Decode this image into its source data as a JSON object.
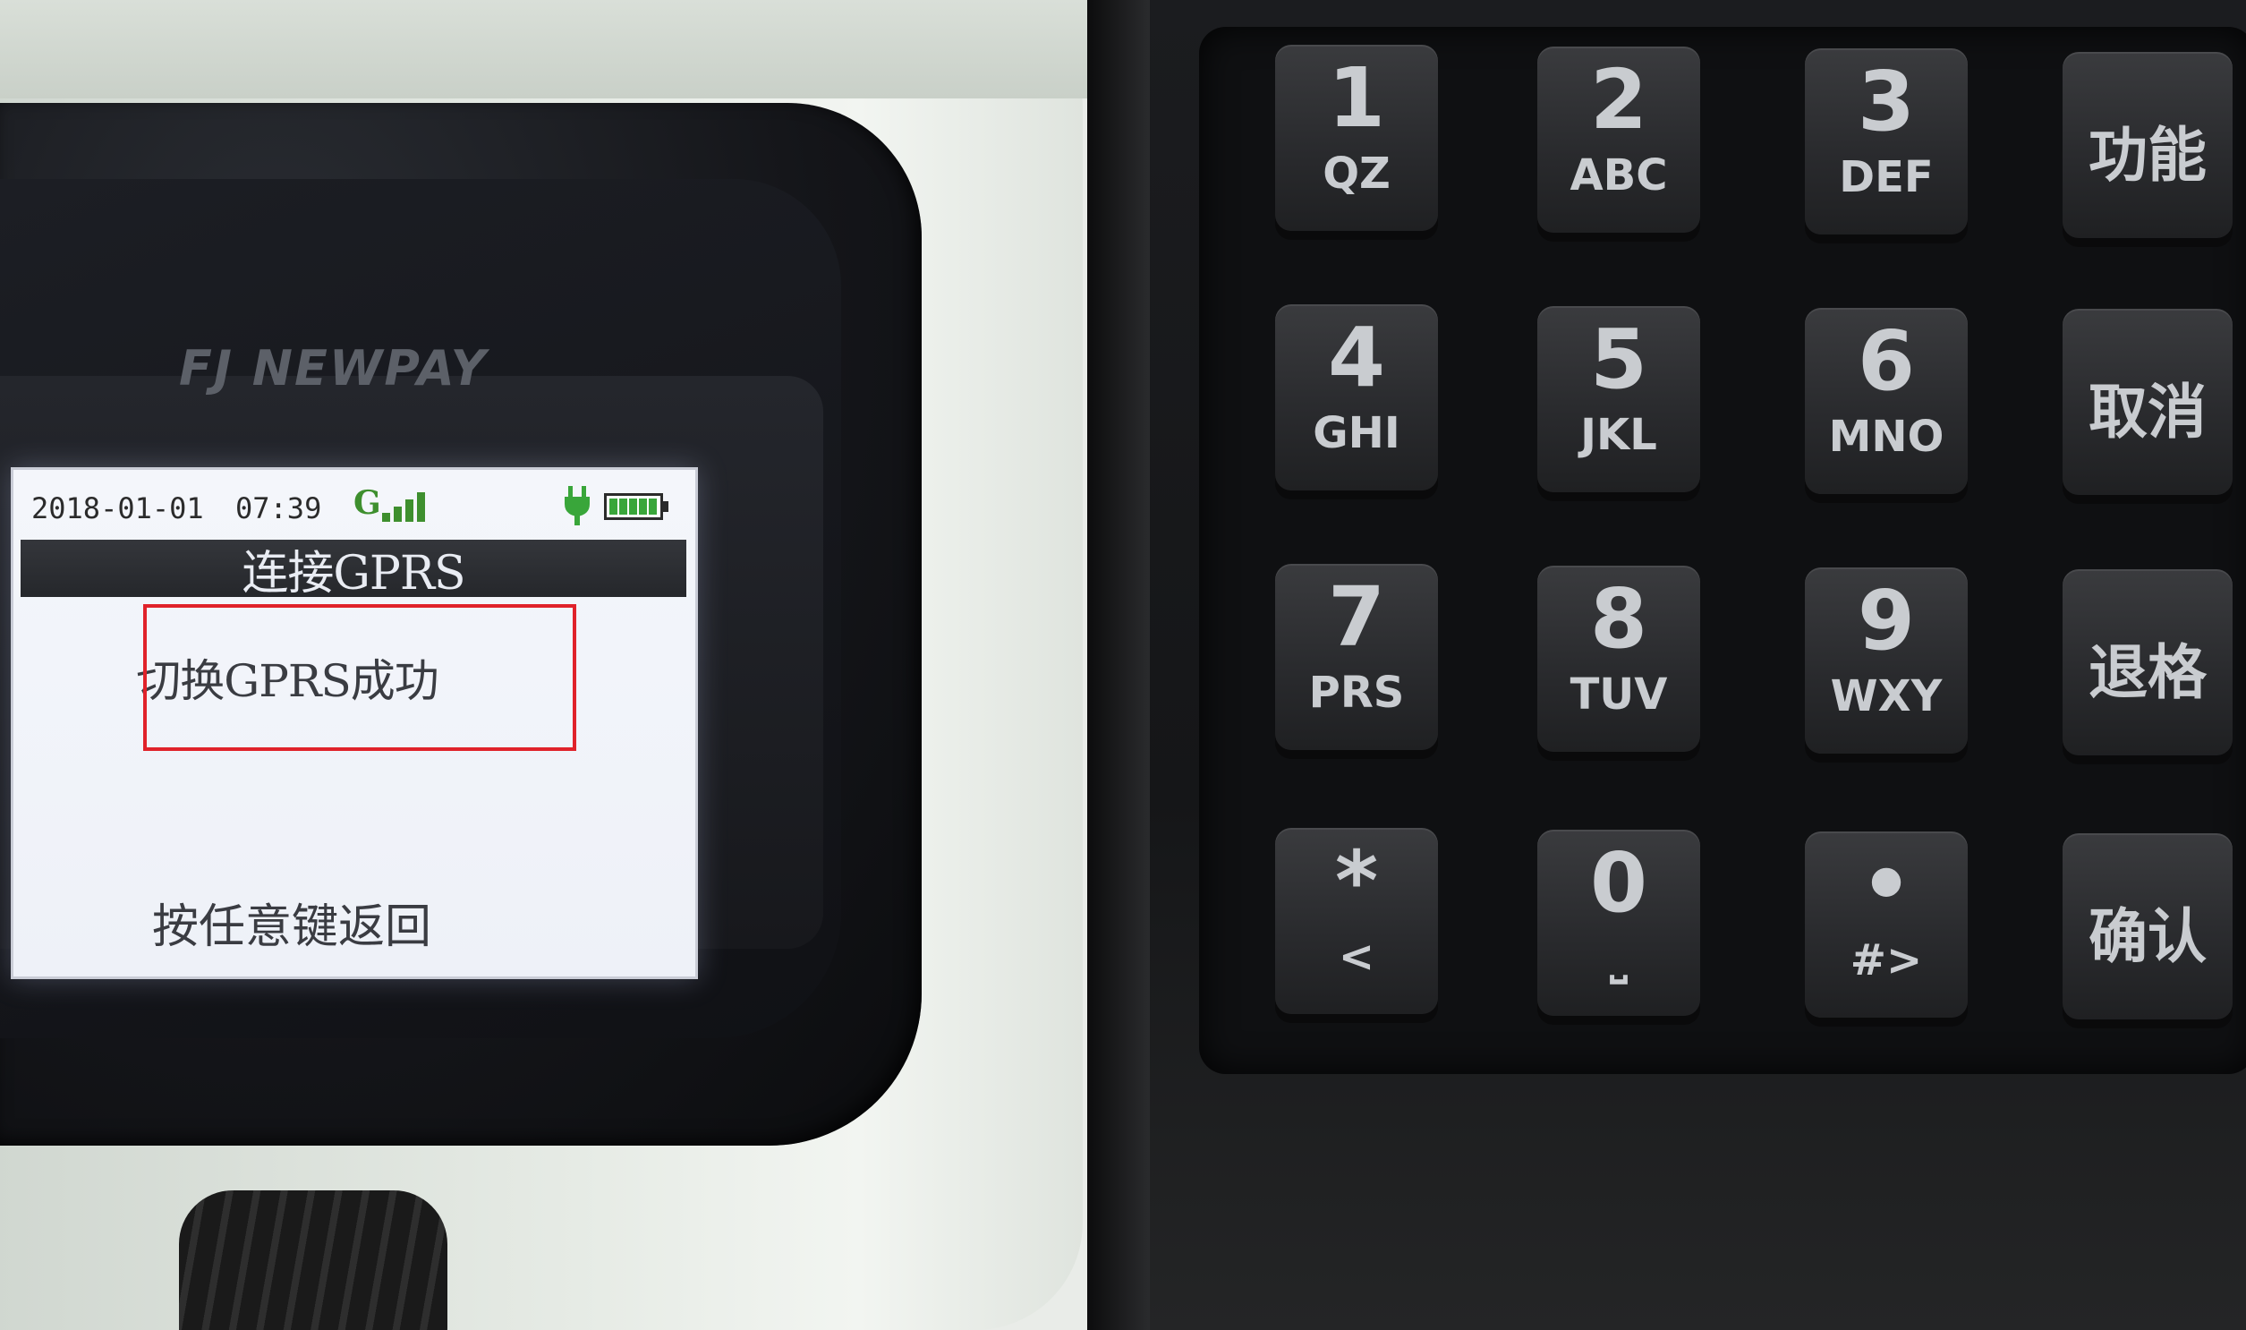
{
  "terminal": {
    "brand": "FJ NEWPAY",
    "screen": {
      "date": "2018-01-01",
      "time": "07:39",
      "signal_label": "G",
      "title": "连接GPRS",
      "message": "切换GPRS成功",
      "footer": "按任意键返回"
    }
  },
  "keypad": {
    "rows": [
      [
        {
          "digit": "1",
          "letters": "QZ"
        },
        {
          "digit": "2",
          "letters": "ABC"
        },
        {
          "digit": "3",
          "letters": "DEF"
        },
        {
          "label": "功能"
        }
      ],
      [
        {
          "digit": "4",
          "letters": "GHI"
        },
        {
          "digit": "5",
          "letters": "JKL"
        },
        {
          "digit": "6",
          "letters": "MNO"
        },
        {
          "label": "取消"
        }
      ],
      [
        {
          "digit": "7",
          "letters": "PRS"
        },
        {
          "digit": "8",
          "letters": "TUV"
        },
        {
          "digit": "9",
          "letters": "WXY"
        },
        {
          "label": "退格"
        }
      ],
      [
        {
          "digit": "*",
          "letters": "<"
        },
        {
          "digit": "0",
          "letters": "⎵"
        },
        {
          "digit": "•",
          "letters": "#>"
        },
        {
          "label": "确认"
        }
      ]
    ]
  },
  "colors": {
    "highlight_border": "#e0222a",
    "signal": "#3e8f2e",
    "battery": "#39a63a"
  }
}
